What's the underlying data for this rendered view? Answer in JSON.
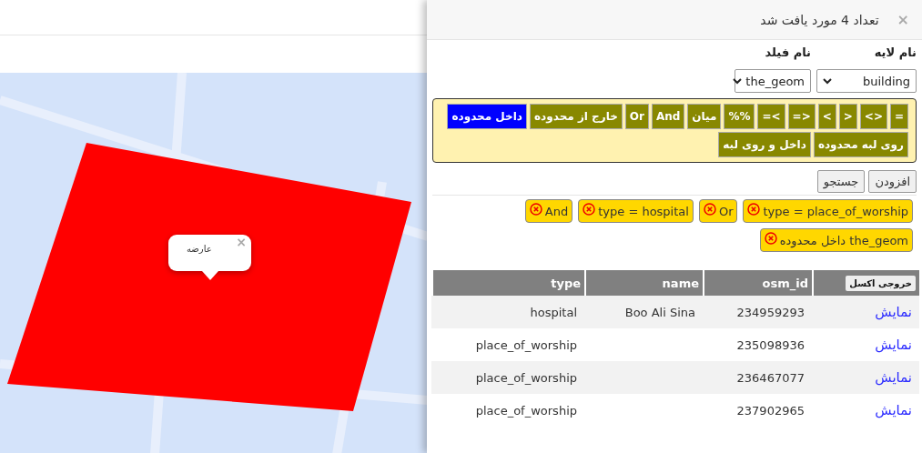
{
  "map": {
    "popup": {
      "text": "عارضه",
      "close": "×"
    }
  },
  "panel": {
    "title": "تعداد 4 مورد یافت شد",
    "close": "×",
    "layer": {
      "label": "نام لایه",
      "value": "building"
    },
    "field": {
      "label": "نام فیلد",
      "value": "the_geom"
    },
    "operators": [
      {
        "label": "=",
        "selected": false
      },
      {
        "label": "<>",
        "selected": false
      },
      {
        "label": ">",
        "selected": false
      },
      {
        "label": "<",
        "selected": false
      },
      {
        "label": "=>",
        "selected": false
      },
      {
        "label": "=<",
        "selected": false
      },
      {
        "label": "%%",
        "selected": false
      },
      {
        "label": "میان",
        "selected": false
      },
      {
        "label": "And",
        "selected": false
      },
      {
        "label": "Or",
        "selected": false
      },
      {
        "label": "خارج از محدوده",
        "selected": false
      },
      {
        "label": "داخل محدوده",
        "selected": true
      },
      {
        "label": "روی لبه محدوده",
        "selected": false
      },
      {
        "label": "داخل و روی لبه",
        "selected": false
      }
    ],
    "buttons": [
      "افزودن",
      "جستجو"
    ],
    "conditions": [
      {
        "text": "type = place_of_worship"
      },
      {
        "text": "Or"
      },
      {
        "text": "type = hospital"
      },
      {
        "text": "And"
      },
      {
        "text": "the_geom داخل محدوده"
      }
    ],
    "table": {
      "export_button": "خروجی اکسل",
      "columns": [
        "osm_id",
        "name",
        "type"
      ],
      "rows": [
        {
          "link": "نمایش",
          "osm_id": "234959293",
          "name": "Boo Ali Sina",
          "type": "hospital"
        },
        {
          "link": "نمایش",
          "osm_id": "235098936",
          "name": "",
          "type": "place_of_worship"
        },
        {
          "link": "نمایش",
          "osm_id": "236467077",
          "name": "",
          "type": "place_of_worship"
        },
        {
          "link": "نمایش",
          "osm_id": "237902965",
          "name": "",
          "type": "place_of_worship"
        }
      ]
    }
  }
}
